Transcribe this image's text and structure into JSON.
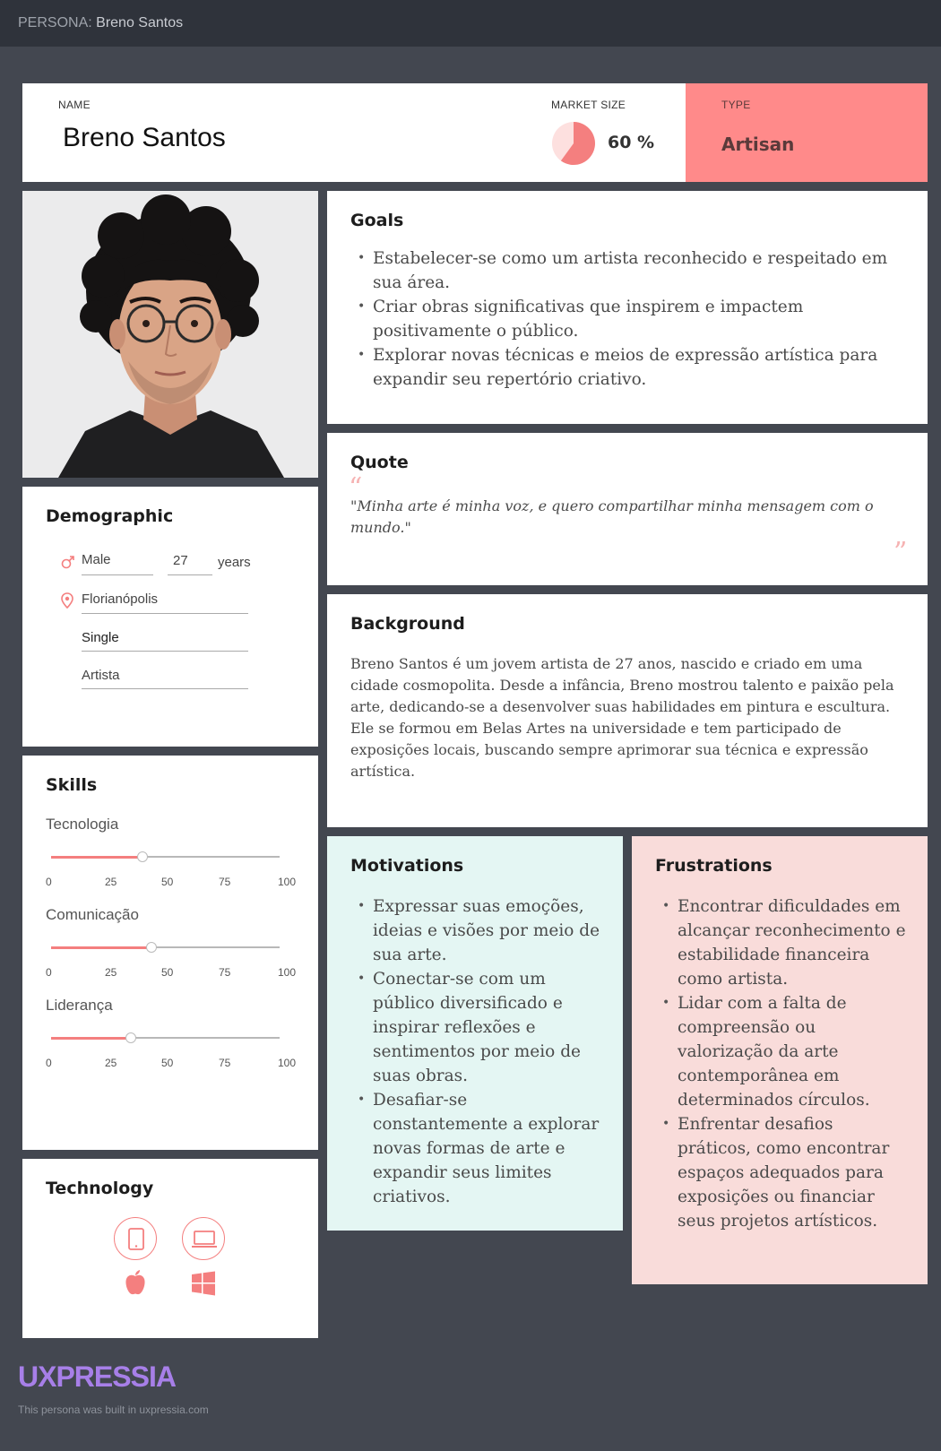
{
  "topbar": {
    "prefix": "PERSONA:",
    "name": "Breno Santos"
  },
  "header": {
    "name_label": "NAME",
    "name": "Breno Santos",
    "market_size_label": "MARKET SIZE",
    "market_size_value": "60 %",
    "market_size_fraction": 0.6,
    "type_label": "TYPE",
    "type_value": "Artisan"
  },
  "goals": {
    "title": "Goals",
    "items": [
      "Estabelecer-se como um artista reconhecido e respeitado em sua área.",
      "Criar obras significativas que inspirem e impactem positivamente o público.",
      "Explorar novas técnicas e meios de expressão artística para expandir seu repertório criativo."
    ]
  },
  "quote": {
    "title": "Quote",
    "open_mark": "“",
    "close_mark": "”",
    "text": "\"Minha arte é minha voz, e quero compartilhar minha mensagem com o mundo.\""
  },
  "background": {
    "title": "Background",
    "text": "Breno Santos é um jovem artista de 27 anos, nascido e criado em uma cidade cosmopolita. Desde a infância, Breno mostrou talento e paixão pela arte, dedicando-se a desenvolver suas habilidades em pintura e escultura. Ele se formou em Belas Artes na universidade e tem participado de exposições locais, buscando sempre aprimorar sua técnica e expressão artística."
  },
  "demographic": {
    "title": "Demographic",
    "gender": "Male",
    "age": "27",
    "age_unit": "years",
    "location": "Florianópolis",
    "marital_status": "Single",
    "occupation": "Artista",
    "icons": {
      "gender": "male-icon",
      "location": "location-pin-icon"
    }
  },
  "skills": {
    "title": "Skills",
    "ticks": [
      "0",
      "25",
      "50",
      "75",
      "100"
    ],
    "items": [
      {
        "label": "Tecnologia",
        "value": 40
      },
      {
        "label": "Comunicação",
        "value": 44
      },
      {
        "label": "Liderança",
        "value": 35
      }
    ]
  },
  "technology": {
    "title": "Technology",
    "icons": [
      "tablet-icon",
      "laptop-icon",
      "apple-icon",
      "windows-icon"
    ]
  },
  "motivations": {
    "title": "Motivations",
    "items": [
      "Expressar suas emoções, ideias e visões por meio de sua arte.",
      "Conectar-se com um público diversificado e inspirar reflexões e sentimentos por meio de suas obras.",
      "Desafiar-se constantemente a explorar novas formas de arte e expandir seus limites criativos."
    ]
  },
  "frustrations": {
    "title": "Frustrations",
    "items": [
      "Encontrar dificuldades em alcançar reconhecimento e estabilidade financeira como artista.",
      "Lidar com a falta de compreensão ou valorização da arte contemporânea em determinados círculos.",
      "Enfrentar desafios práticos, como encontrar espaços adequados para exposições ou financiar seus projetos artísticos."
    ]
  },
  "footer": {
    "logo": "UXPRESSIA",
    "text": "This persona was built in uxpressia.com"
  },
  "colors": {
    "accent": "#ff8a8a",
    "motivations_bg": "#e4f6f3",
    "frustrations_bg": "#f9dcda",
    "page_bg": "#434750"
  }
}
